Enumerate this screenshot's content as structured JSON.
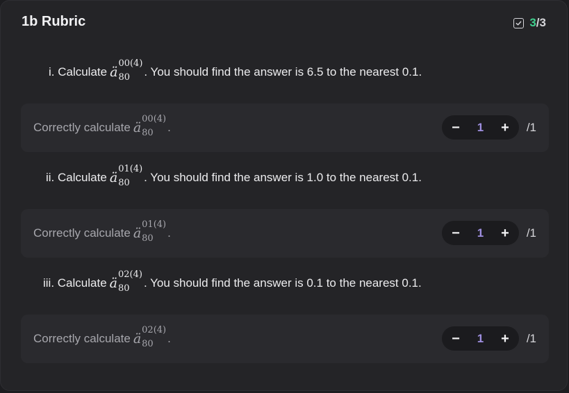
{
  "header": {
    "title": "1b Rubric",
    "score_earned": "3",
    "score_sep": "/",
    "score_total": "3"
  },
  "questions": [
    {
      "prefix": "i. Calculate",
      "base": "ä",
      "sup": "00(4)",
      "sub": "80",
      "suffix": ". You should find the answer is 6.5 to the nearest 0.1.",
      "criterion": {
        "label": "Correctly calculate",
        "sup": "00(4)",
        "sub": "80",
        "end": ".",
        "value": "1",
        "max": "/1"
      }
    },
    {
      "prefix": "ii. Calculate",
      "base": "ä",
      "sup": "01(4)",
      "sub": "80",
      "suffix": ". You should find the answer is 1.0 to the nearest 0.1.",
      "criterion": {
        "label": "Correctly calculate",
        "sup": "01(4)",
        "sub": "80",
        "end": ".",
        "value": "1",
        "max": "/1"
      }
    },
    {
      "prefix": "iii. Calculate",
      "base": "ä",
      "sup": "02(4)",
      "sub": "80",
      "suffix": ". You should find the answer is 0.1 to the nearest 0.1.",
      "criterion": {
        "label": "Correctly calculate",
        "sup": "02(4)",
        "sub": "80",
        "end": ".",
        "value": "1",
        "max": "/1"
      }
    }
  ],
  "stepper": {
    "minus": "−",
    "plus": "+"
  },
  "icons": {
    "score": "checkbox-checked-icon"
  },
  "colors": {
    "earned": "#3fcf8e",
    "value": "#9f8fe0",
    "background": "#242427"
  }
}
